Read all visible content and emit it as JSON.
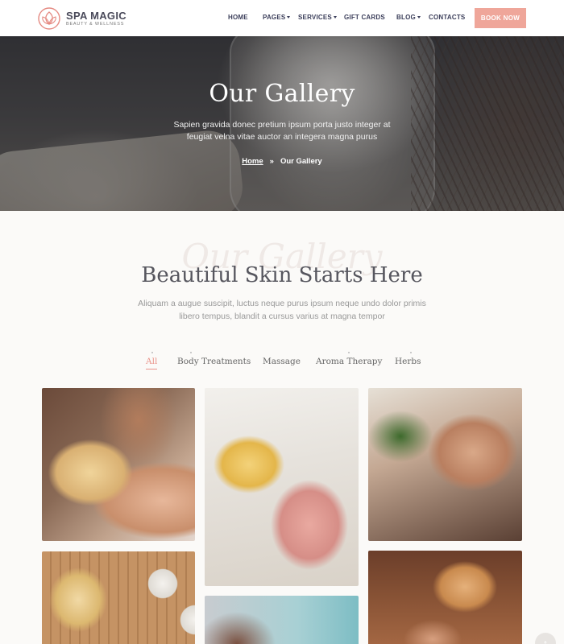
{
  "brand": {
    "name": "SPA MAGIC",
    "tagline": "BEAUTY & WELLNESS"
  },
  "nav": {
    "items": [
      {
        "label": "HOME"
      },
      {
        "label": "PAGES"
      },
      {
        "label": "SERVICES"
      },
      {
        "label": "GIFT CARDS"
      },
      {
        "label": "BLOG"
      },
      {
        "label": "CONTACTS"
      }
    ],
    "book_label": "BOOK NOW"
  },
  "hero": {
    "title": "Our Gallery",
    "subtitle_line1": "Sapien gravida donec pretium ipsum porta justo integer at",
    "subtitle_line2": "feugiat velna vitae auctor an integera magna purus",
    "breadcrumb": {
      "home": "Home",
      "separator": "»",
      "current": "Our Gallery"
    }
  },
  "section": {
    "ghost": "Our Gallery",
    "title": "Beautiful Skin Starts Here",
    "subtitle_line1": "Aliquam a augue suscipit, luctus neque purus ipsum neque undo dolor primis",
    "subtitle_line2": "libero tempus, blandit a cursus varius at magna tempor"
  },
  "filters": [
    {
      "label": "All"
    },
    {
      "label": "Body Treatments"
    },
    {
      "label": "Massage"
    },
    {
      "label": "Aroma Therapy"
    },
    {
      "label": "Herbs"
    }
  ],
  "scroll_top": "↑",
  "colors": {
    "accent": "#efa69a",
    "nav_text": "#3b3e5a",
    "active_filter": "#e9938a"
  }
}
